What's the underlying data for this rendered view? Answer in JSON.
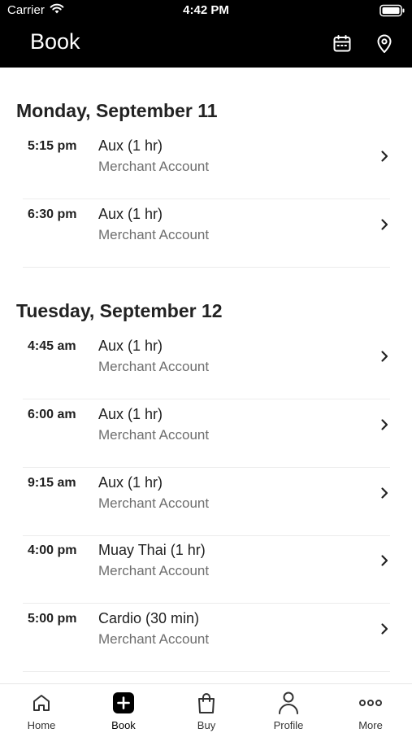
{
  "status_bar": {
    "carrier": "Carrier",
    "time": "4:42 PM"
  },
  "header": {
    "title": "Book"
  },
  "days": [
    {
      "heading": "Monday, September 11",
      "classes": [
        {
          "time": "5:15 pm",
          "name": "Aux (1 hr)",
          "merchant": "Merchant Account"
        },
        {
          "time": "6:30 pm",
          "name": "Aux (1 hr)",
          "merchant": "Merchant Account"
        }
      ]
    },
    {
      "heading": "Tuesday, September 12",
      "classes": [
        {
          "time": "4:45 am",
          "name": "Aux (1 hr)",
          "merchant": "Merchant Account"
        },
        {
          "time": "6:00 am",
          "name": "Aux (1 hr)",
          "merchant": "Merchant Account"
        },
        {
          "time": "9:15 am",
          "name": "Aux (1 hr)",
          "merchant": "Merchant Account"
        },
        {
          "time": "4:00 pm",
          "name": "Muay Thai (1 hr)",
          "merchant": "Merchant Account"
        },
        {
          "time": "5:00 pm",
          "name": "Cardio (30 min)",
          "merchant": "Merchant Account"
        }
      ]
    }
  ],
  "tabbar": {
    "active": "Book",
    "items": [
      {
        "label": "Home",
        "icon": "home-icon"
      },
      {
        "label": "Book",
        "icon": "plus-square-icon"
      },
      {
        "label": "Buy",
        "icon": "shopping-bag-icon"
      },
      {
        "label": "Profile",
        "icon": "person-icon"
      },
      {
        "label": "More",
        "icon": "more-dots-icon"
      }
    ]
  }
}
